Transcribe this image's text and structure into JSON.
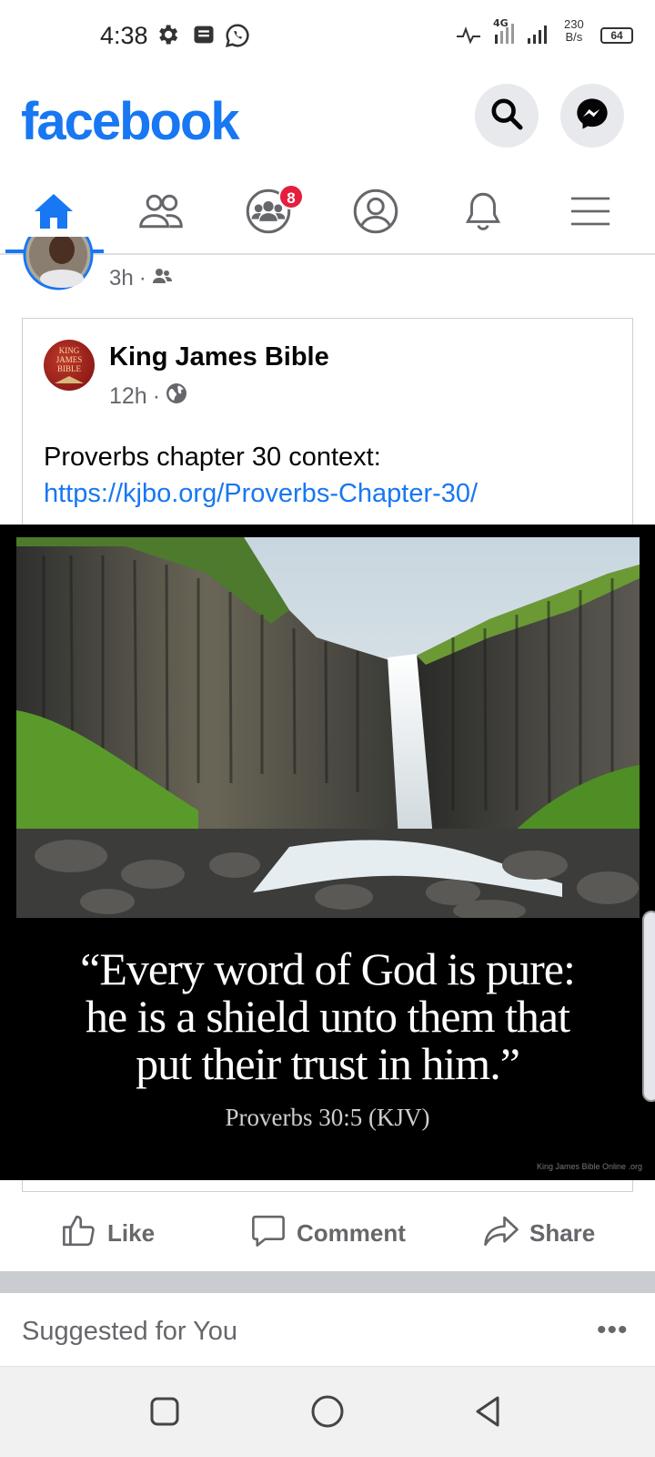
{
  "status_bar": {
    "time": "4:38",
    "network": "4G",
    "speed_value": "230",
    "speed_unit": "B/s",
    "battery": "64"
  },
  "header": {
    "logo": "facebook",
    "brand_color": "#1877f2"
  },
  "nav": {
    "items": [
      {
        "name": "home",
        "icon": "home-icon",
        "active": true
      },
      {
        "name": "friends",
        "icon": "friends-icon"
      },
      {
        "name": "groups",
        "icon": "groups-icon",
        "badge": "8"
      },
      {
        "name": "profile",
        "icon": "profile-icon"
      },
      {
        "name": "notifications",
        "icon": "bell-icon"
      },
      {
        "name": "menu",
        "icon": "hamburger-icon"
      }
    ]
  },
  "previous_post": {
    "time": "3h",
    "audience_icon": "friends-icon"
  },
  "post": {
    "page_name": "King James Bible",
    "avatar_text": [
      "KING",
      "JAMES",
      "BIBLE"
    ],
    "time": "12h",
    "audience_icon": "globe-icon",
    "text": "Proverbs chapter 30 context:",
    "link": "https://kjbo.org/Proverbs-Chapter-30/",
    "image": {
      "quote_lines": [
        "“Every word of God is pure:",
        "he is a shield unto them that",
        "put their trust in him.”"
      ],
      "citation": "Proverbs 30:5 (KJV)",
      "watermark": "King James Bible Online .org"
    }
  },
  "actions": {
    "like": "Like",
    "comment": "Comment",
    "share": "Share"
  },
  "suggested": {
    "title": "Suggested for You",
    "more": "•••"
  },
  "colors": {
    "accent": "#1877f2",
    "badge": "#e41e3f",
    "secondary_text": "#65676b"
  }
}
